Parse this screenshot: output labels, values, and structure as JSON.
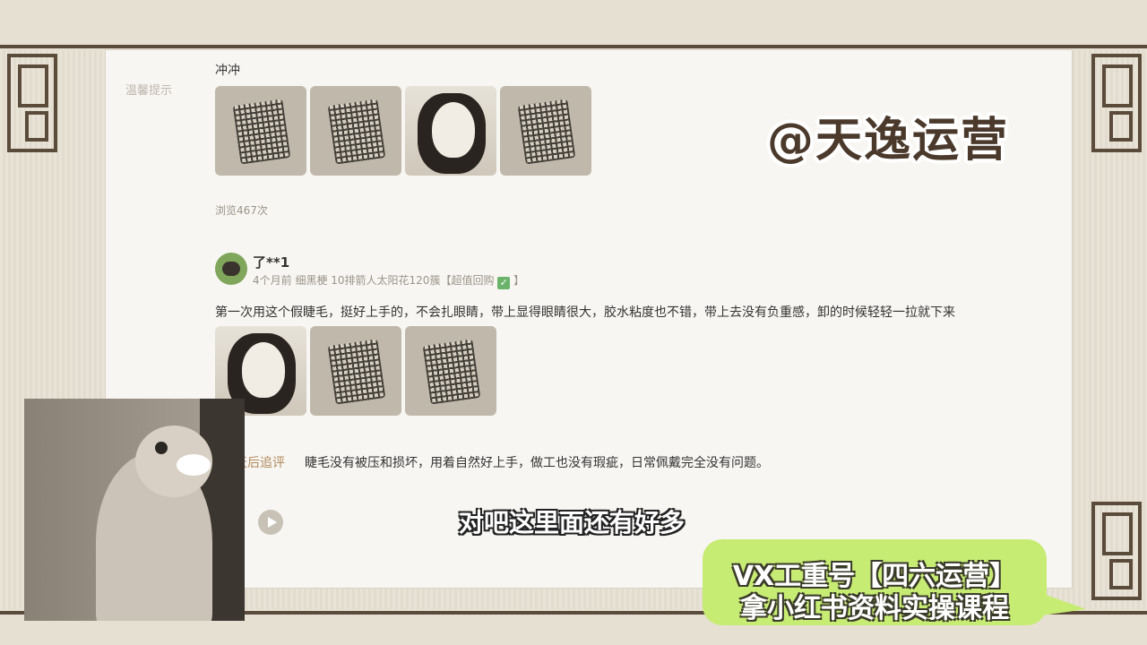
{
  "review_top": {
    "text_tail": "冲冲",
    "side_label": "温馨提示",
    "views": "浏览467次"
  },
  "review": {
    "username": "了**1",
    "meta": "4个月前 细黑梗 10排箭人太阳花120簇【超值回购",
    "badge": "✓",
    "meta_close": "】",
    "content": "第一次用这个假睫毛，挺好上手的，不会扎眼睛，带上显得眼睛很大，胶水粘度也不错，带上去没有负重感，卸的时候轻轻一拉就下来",
    "followup_label": "天后追评",
    "followup": "睫毛没有被压和损坏，用着自然好上手，做工也没有瑕疵，日常佩戴完全没有问题。"
  },
  "overlay": {
    "watermark": "@天逸运营",
    "subtitle": "对吧这里面还有好多",
    "promo_line1": "VX工重号【四六运营】",
    "promo_line2": "拿小红书资料实操课程"
  },
  "colors": {
    "bubble": "#c7ec73",
    "frame": "#5b4b3a",
    "panel": "#f8f6f2"
  }
}
